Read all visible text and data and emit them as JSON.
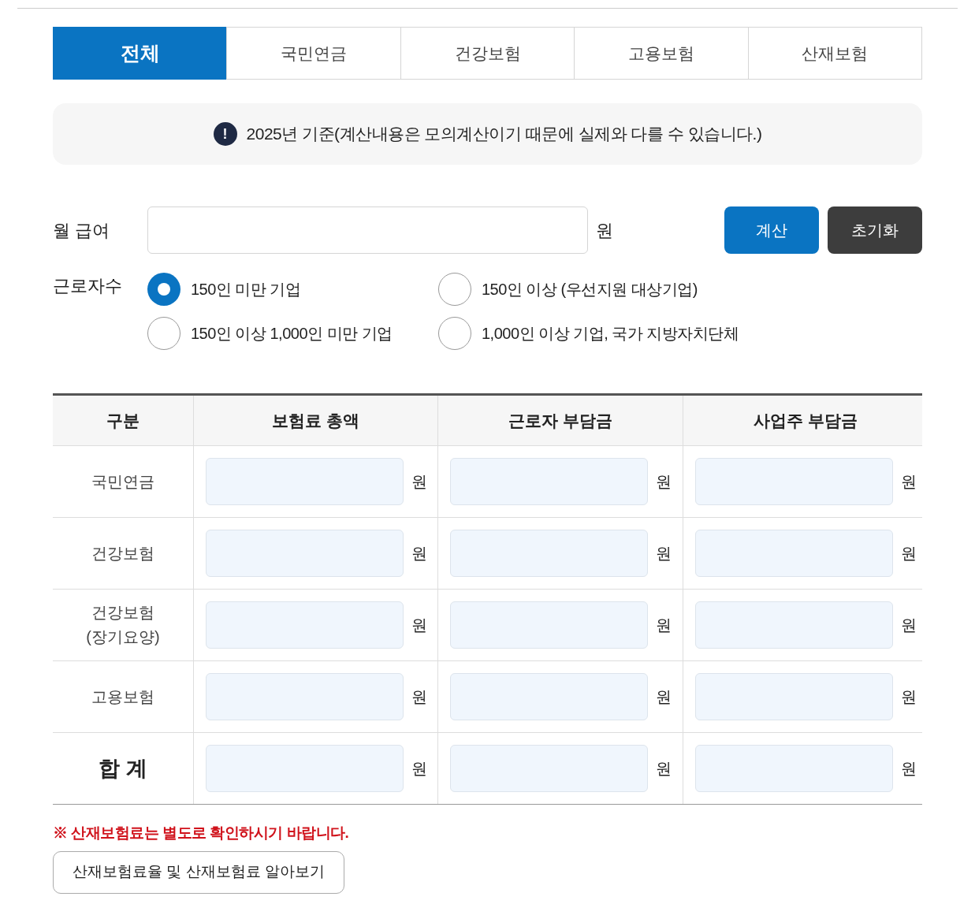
{
  "tabs": [
    {
      "label": "전체",
      "selected": true
    },
    {
      "label": "국민연금",
      "selected": false
    },
    {
      "label": "건강보험",
      "selected": false
    },
    {
      "label": "고용보험",
      "selected": false
    },
    {
      "label": "산재보험",
      "selected": false
    }
  ],
  "notice": {
    "icon": "!",
    "text": "2025년 기준(계산내용은 모의계산이기 때문에 실제와 다를 수 있습니다.)"
  },
  "salary": {
    "label": "월 급여",
    "unit": "원"
  },
  "buttons": [
    {
      "label": "계산",
      "kind": "primary"
    },
    {
      "label": "초기화",
      "kind": "dark"
    }
  ],
  "workers": {
    "label": "근로자수",
    "options": [
      {
        "label": "150인 미만 기업",
        "selected": true
      },
      {
        "label": "150인 이상 (우선지원 대상기업)",
        "selected": false
      },
      {
        "label": "150인 이상 1,000인 미만 기업",
        "selected": false
      },
      {
        "label": "1,000인 이상 기업, 국가 지방자치단체",
        "selected": false
      }
    ]
  },
  "table": {
    "columns": [
      "구분",
      "보험료 총액",
      "근로자 부담금",
      "사업주 부담금"
    ],
    "rows": [
      {
        "label": "국민연금",
        "kind": "item",
        "units": [
          "원",
          "원",
          "원"
        ]
      },
      {
        "label": "건강보험",
        "kind": "item",
        "units": [
          "원",
          "원",
          "원"
        ]
      },
      {
        "label": "건강보험\n(장기요양)",
        "kind": "item",
        "units": [
          "원",
          "원",
          "원"
        ]
      },
      {
        "label": "고용보험",
        "kind": "item",
        "units": [
          "원",
          "원",
          "원"
        ]
      },
      {
        "label": "합 계",
        "kind": "total",
        "units": [
          "원",
          "원",
          "원"
        ]
      }
    ]
  },
  "note": "※ 산재보험료는 별도로 확인하시기 바랍니다.",
  "link_button": "산재보험료율 및 산재보험료 알아보기"
}
